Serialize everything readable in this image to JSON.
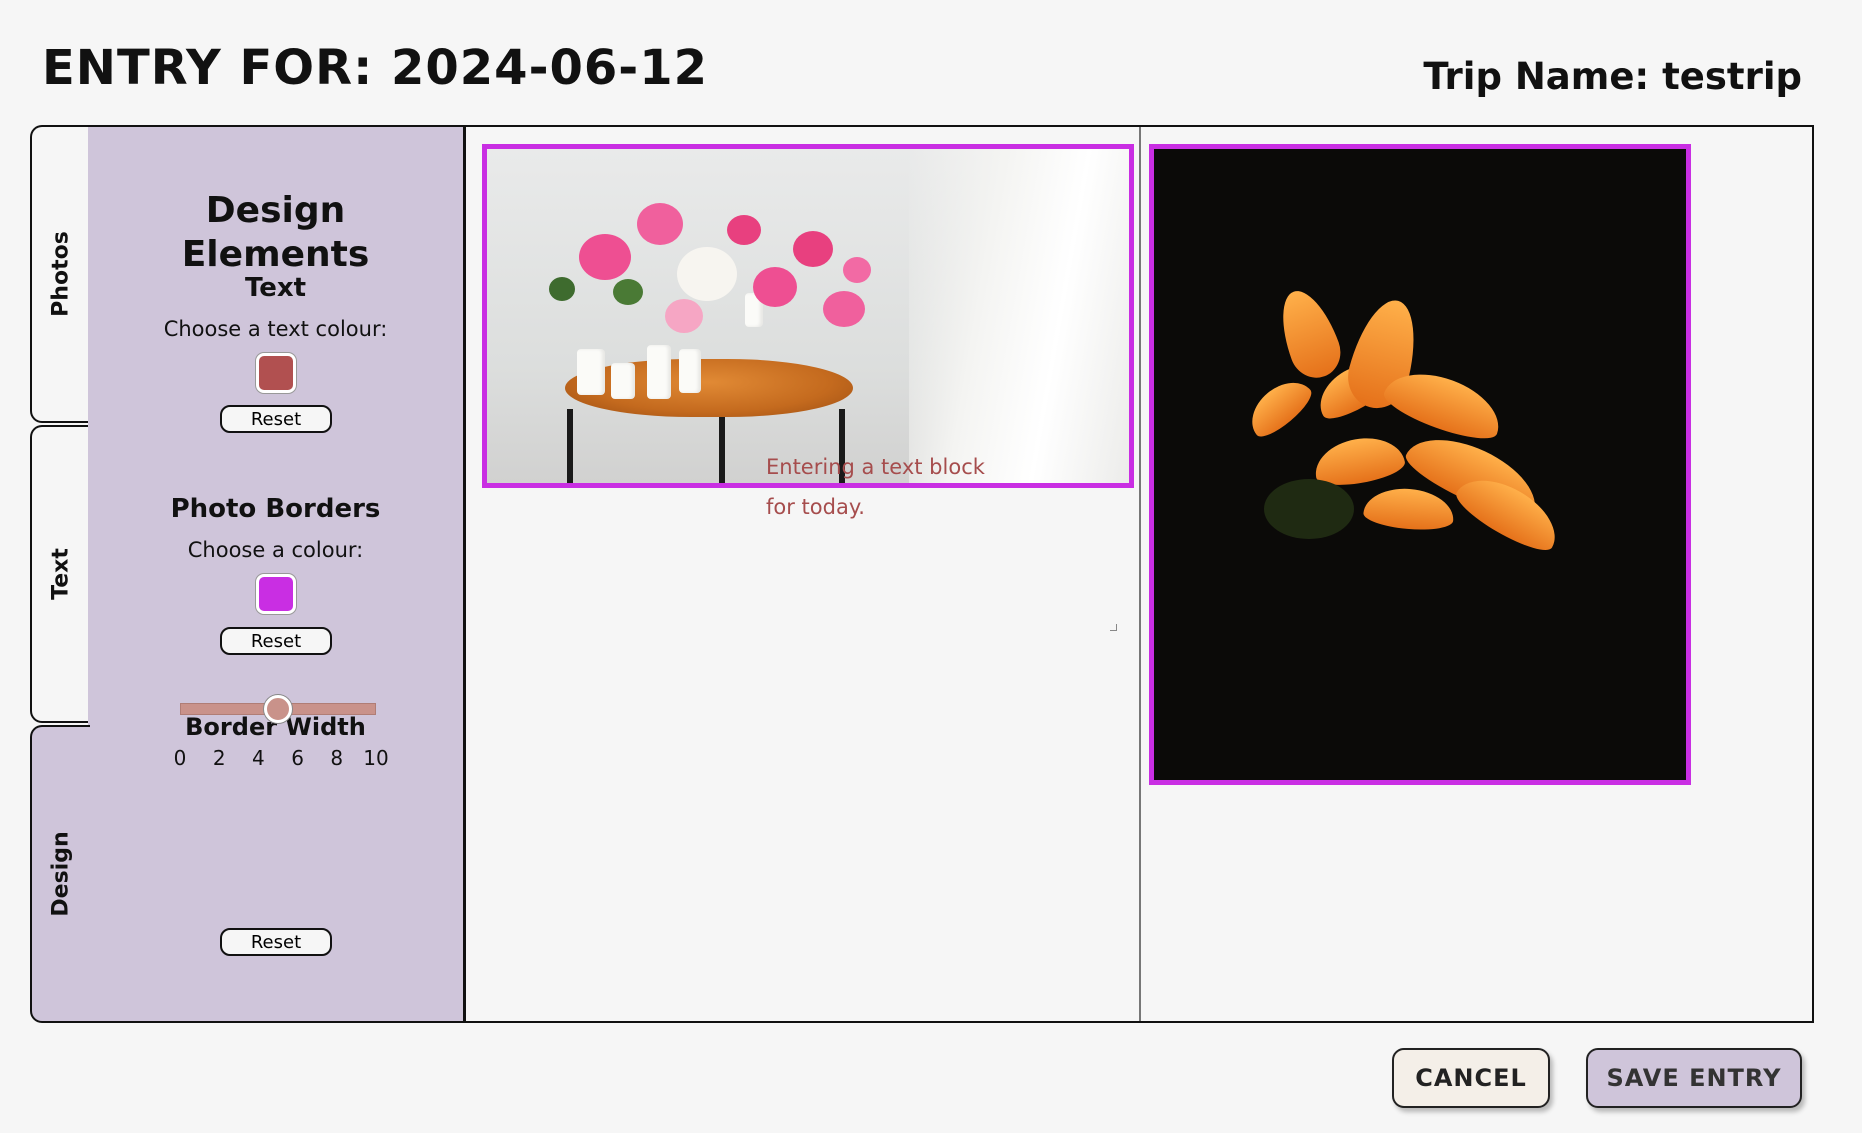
{
  "header": {
    "entry_title": "ENTRY FOR: 2024-06-12",
    "trip_name": "Trip Name: testrip"
  },
  "tabs": [
    {
      "label": "Photos",
      "active": false
    },
    {
      "label": "Text",
      "active": false
    },
    {
      "label": "Design",
      "active": true
    }
  ],
  "design_panel": {
    "heading": "Design Elements",
    "text_section": {
      "heading": "Text",
      "label": "Choose a text colour:",
      "color": "#b15050",
      "reset_label": "Reset"
    },
    "border_section": {
      "heading": "Photo Borders",
      "label": "Choose a colour:",
      "color": "#c92ee3",
      "reset_label": "Reset"
    },
    "width_section": {
      "heading": "Border Width",
      "value": 5,
      "min": 0,
      "max": 10,
      "ticks": [
        "0",
        "2",
        "4",
        "6",
        "8",
        "10"
      ],
      "reset_label": "Reset"
    }
  },
  "canvas": {
    "text_block": "Entering a text block for today.",
    "text_color": "#a64d4d",
    "border_color": "#c92ee3"
  },
  "footer": {
    "cancel_label": "CANCEL",
    "save_label": "SAVE ENTRY"
  }
}
